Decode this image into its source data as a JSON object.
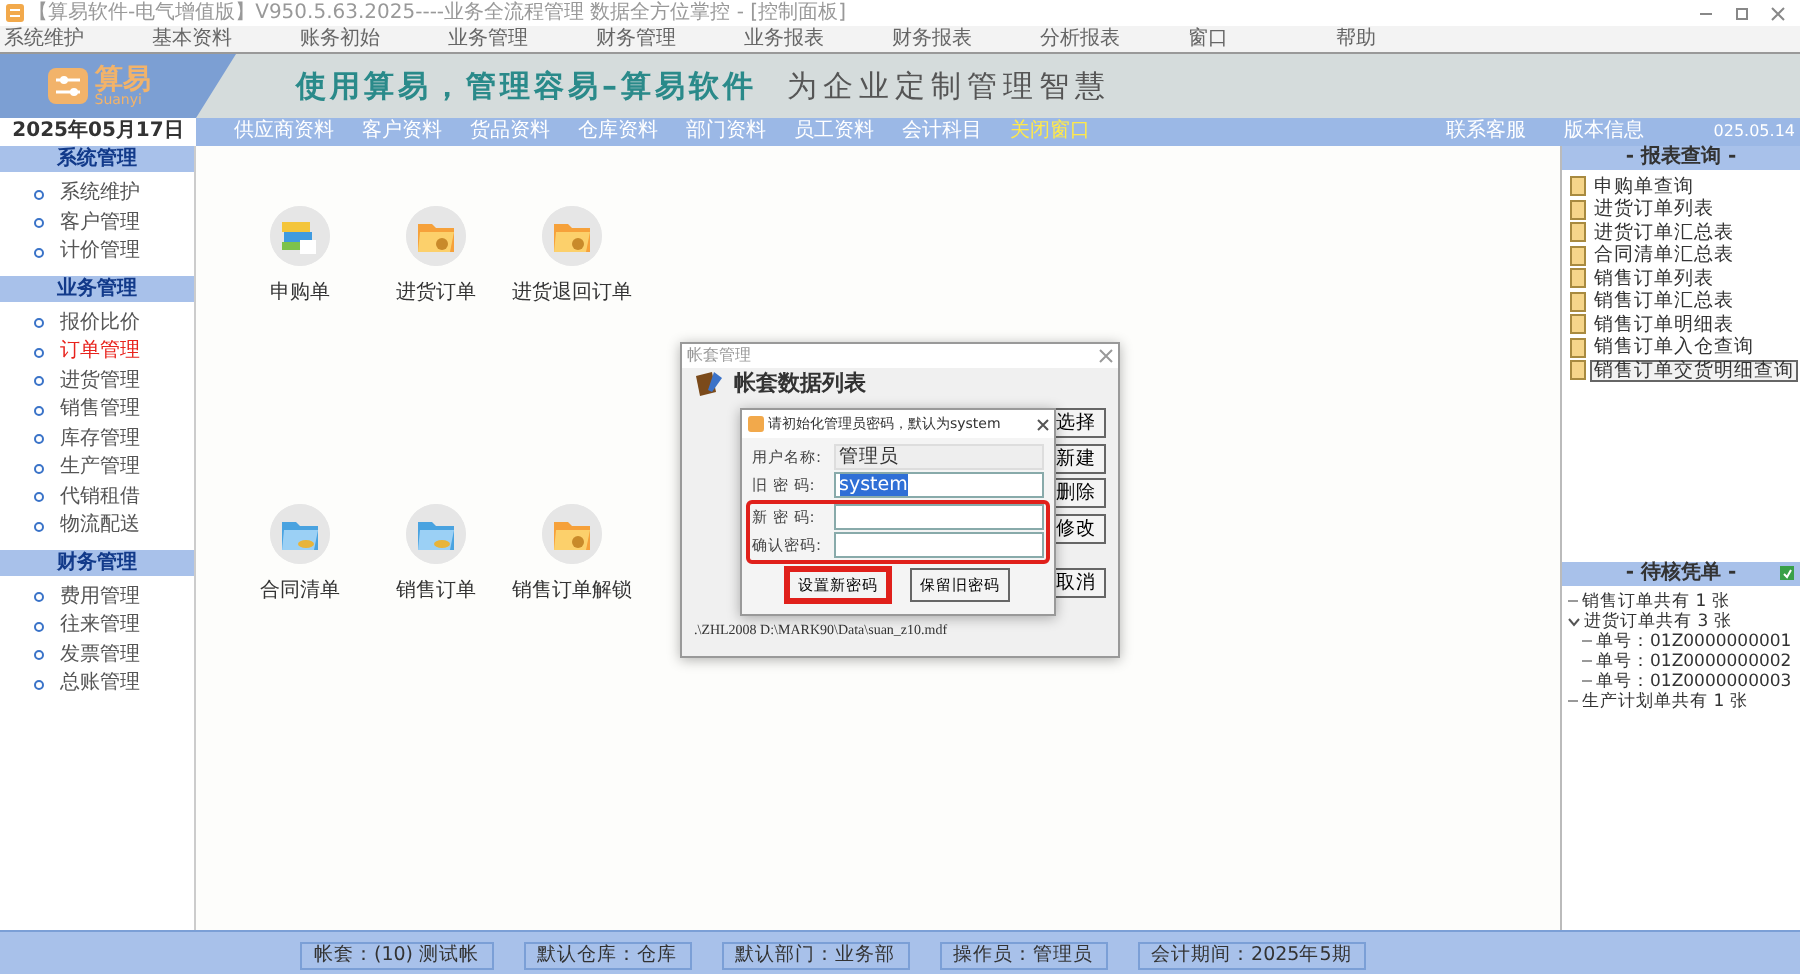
{
  "window": {
    "title": "【算易软件-电气增值版】V950.5.63.2025----业务全流程管理 数据全方位掌控 - [控制面板]"
  },
  "menu": [
    "系统维护",
    "基本资料",
    "账务初始",
    "业务管理",
    "财务管理",
    "业务报表",
    "财务报表",
    "分析报表",
    "窗口",
    "帮助"
  ],
  "banner": {
    "logo": "算易",
    "logo_sub": "Suanyi",
    "slogan": "使用算易，管理容易–算易软件",
    "motto": "为企业定制管理智慧"
  },
  "date": "2025年05月17日",
  "nav_links": [
    {
      "label": "供应商资料",
      "highlighted": false
    },
    {
      "label": "客户资料",
      "highlighted": false
    },
    {
      "label": "货品资料",
      "highlighted": false
    },
    {
      "label": "仓库资料",
      "highlighted": false
    },
    {
      "label": "部门资料",
      "highlighted": false
    },
    {
      "label": "员工资料",
      "highlighted": false
    },
    {
      "label": "会计科目",
      "highlighted": false
    },
    {
      "label": "关闭窗口",
      "highlighted": true
    }
  ],
  "nav_right": [
    "联系客服",
    "版本信息"
  ],
  "nav_date": "025.05.14",
  "sidebar": {
    "sections": [
      {
        "title": "系统管理",
        "items": [
          {
            "label": "系统维护",
            "selected": false
          },
          {
            "label": "客户管理",
            "selected": false
          },
          {
            "label": "计价管理",
            "selected": false
          }
        ]
      },
      {
        "title": "业务管理",
        "items": [
          {
            "label": "报价比价",
            "selected": false
          },
          {
            "label": "订单管理",
            "selected": true
          },
          {
            "label": "进货管理",
            "selected": false
          },
          {
            "label": "销售管理",
            "selected": false
          },
          {
            "label": "库存管理",
            "selected": false
          },
          {
            "label": "生产管理",
            "selected": false
          },
          {
            "label": "代销租借",
            "selected": false
          },
          {
            "label": "物流配送",
            "selected": false
          }
        ]
      },
      {
        "title": "财务管理",
        "items": [
          {
            "label": "费用管理",
            "selected": false
          },
          {
            "label": "往来管理",
            "selected": false
          },
          {
            "label": "发票管理",
            "selected": false
          },
          {
            "label": "总账管理",
            "selected": false
          }
        ]
      }
    ]
  },
  "tiles": [
    {
      "label": "申购单",
      "kind": "books"
    },
    {
      "label": "进货订单",
      "kind": "folder"
    },
    {
      "label": "进货退回订单",
      "kind": "folder"
    },
    {
      "label": "合同清单",
      "kind": "bluefolder"
    },
    {
      "label": "销售订单",
      "kind": "bluefolder"
    },
    {
      "label": "销售订单解锁",
      "kind": "folder"
    }
  ],
  "back_dialog": {
    "title": "帐套管理",
    "heading": "帐套数据列表",
    "buttons": [
      "选择",
      "新建",
      "删除",
      "修改",
      "取消"
    ],
    "path": ".\\ZHL2008 D:\\MARK90\\Data\\suan_z10.mdf"
  },
  "dialog": {
    "title": "请初始化管理员密码，默认为system",
    "fields": [
      {
        "label": "用户名称:",
        "value": "管理员",
        "kind": "readonly",
        "highlighted": false
      },
      {
        "label": "旧 密 码:",
        "value": "system",
        "kind": "input",
        "highlighted": false
      },
      {
        "label": "新 密 码:",
        "kind": "input",
        "highlighted": true
      },
      {
        "label": "确认密码:",
        "kind": "input",
        "highlighted": true
      }
    ],
    "buttons": [
      {
        "label": "设置新密码",
        "highlighted": true
      },
      {
        "label": "保留旧密码",
        "highlighted": false
      }
    ]
  },
  "reports": {
    "title": "- 报表查询 -",
    "items": [
      {
        "label": "申购单查询",
        "selected": false
      },
      {
        "label": "进货订单列表",
        "selected": false
      },
      {
        "label": "进货订单汇总表",
        "selected": false
      },
      {
        "label": "合同清单汇总表",
        "selected": false
      },
      {
        "label": "销售订单列表",
        "selected": false
      },
      {
        "label": "销售订单汇总表",
        "selected": false
      },
      {
        "label": "销售订单明细表",
        "selected": false
      },
      {
        "label": "销售订单入仓查询",
        "selected": false
      },
      {
        "label": "销售订单交货明细查询",
        "selected": true
      }
    ]
  },
  "pending": {
    "title": "- 待核凭单 -",
    "tree": [
      {
        "label": "销售订单共有 1 张"
      },
      {
        "label": "进货订单共有 3 张",
        "expanded": true,
        "children": [
          {
            "label": "单号：01Z0000000001"
          },
          {
            "label": "单号：01Z0000000002"
          },
          {
            "label": "单号：01Z0000000003"
          }
        ]
      },
      {
        "label": "生产计划单共有 1 张"
      }
    ]
  },
  "status_bar": [
    "帐套：(10) 测试帐",
    "默认仓库：仓库",
    "默认部门：业务部",
    "操作员：管理员",
    "会计期间：2025年5期"
  ]
}
